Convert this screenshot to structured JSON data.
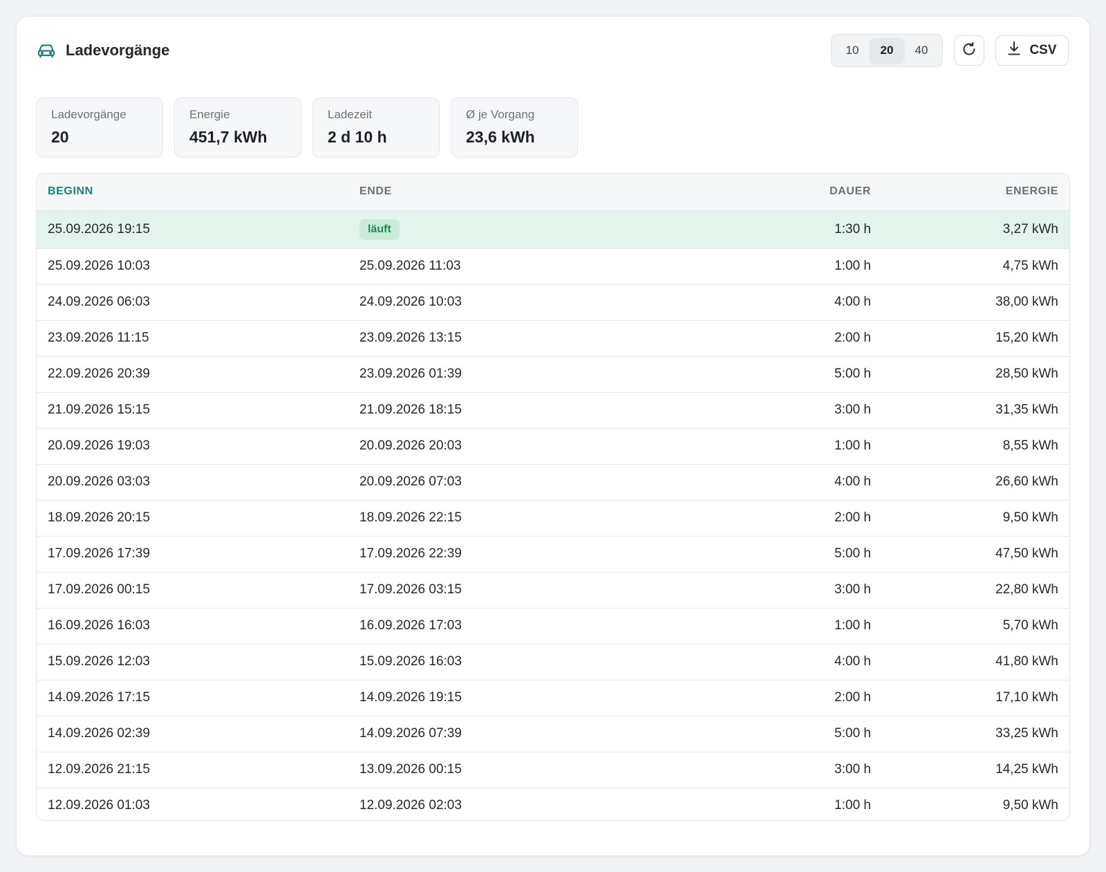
{
  "header": {
    "title": "Ladevorgänge",
    "page_sizes": [
      "10",
      "20",
      "40"
    ],
    "active_page_size": "20",
    "export_label": "CSV"
  },
  "stats": [
    {
      "label": "Ladevorgänge",
      "value": "20"
    },
    {
      "label": "Energie",
      "value": "451,7 kWh"
    },
    {
      "label": "Ladezeit",
      "value": "2 d 10 h"
    },
    {
      "label": "Ø je Vorgang",
      "value": "23,6 kWh"
    }
  ],
  "table": {
    "columns": [
      "BEGINN",
      "ENDE",
      "DAUER",
      "ENERGIE"
    ],
    "sorted_column": "BEGINN",
    "running_label": "läuft",
    "rows": [
      {
        "begin": "25.09.2026 19:15",
        "end": "",
        "running": true,
        "duration": "1:30 h",
        "energy": "3,27 kWh"
      },
      {
        "begin": "25.09.2026 10:03",
        "end": "25.09.2026 11:03",
        "running": false,
        "duration": "1:00 h",
        "energy": "4,75 kWh"
      },
      {
        "begin": "24.09.2026 06:03",
        "end": "24.09.2026 10:03",
        "running": false,
        "duration": "4:00 h",
        "energy": "38,00 kWh"
      },
      {
        "begin": "23.09.2026 11:15",
        "end": "23.09.2026 13:15",
        "running": false,
        "duration": "2:00 h",
        "energy": "15,20 kWh"
      },
      {
        "begin": "22.09.2026 20:39",
        "end": "23.09.2026 01:39",
        "running": false,
        "duration": "5:00 h",
        "energy": "28,50 kWh"
      },
      {
        "begin": "21.09.2026 15:15",
        "end": "21.09.2026 18:15",
        "running": false,
        "duration": "3:00 h",
        "energy": "31,35 kWh"
      },
      {
        "begin": "20.09.2026 19:03",
        "end": "20.09.2026 20:03",
        "running": false,
        "duration": "1:00 h",
        "energy": "8,55 kWh"
      },
      {
        "begin": "20.09.2026 03:03",
        "end": "20.09.2026 07:03",
        "running": false,
        "duration": "4:00 h",
        "energy": "26,60 kWh"
      },
      {
        "begin": "18.09.2026 20:15",
        "end": "18.09.2026 22:15",
        "running": false,
        "duration": "2:00 h",
        "energy": "9,50 kWh"
      },
      {
        "begin": "17.09.2026 17:39",
        "end": "17.09.2026 22:39",
        "running": false,
        "duration": "5:00 h",
        "energy": "47,50 kWh"
      },
      {
        "begin": "17.09.2026 00:15",
        "end": "17.09.2026 03:15",
        "running": false,
        "duration": "3:00 h",
        "energy": "22,80 kWh"
      },
      {
        "begin": "16.09.2026 16:03",
        "end": "16.09.2026 17:03",
        "running": false,
        "duration": "1:00 h",
        "energy": "5,70 kWh"
      },
      {
        "begin": "15.09.2026 12:03",
        "end": "15.09.2026 16:03",
        "running": false,
        "duration": "4:00 h",
        "energy": "41,80 kWh"
      },
      {
        "begin": "14.09.2026 17:15",
        "end": "14.09.2026 19:15",
        "running": false,
        "duration": "2:00 h",
        "energy": "17,10 kWh"
      },
      {
        "begin": "14.09.2026 02:39",
        "end": "14.09.2026 07:39",
        "running": false,
        "duration": "5:00 h",
        "energy": "33,25 kWh"
      },
      {
        "begin": "12.09.2026 21:15",
        "end": "13.09.2026 00:15",
        "running": false,
        "duration": "3:00 h",
        "energy": "14,25 kWh"
      },
      {
        "begin": "12.09.2026 01:03",
        "end": "12.09.2026 02:03",
        "running": false,
        "duration": "1:00 h",
        "energy": "9,50 kWh"
      }
    ]
  },
  "colors": {
    "accent": "#1d7f7a",
    "running_row": "#e3f4ec",
    "running_badge_bg": "#c9ebda",
    "running_badge_text": "#1c8a55"
  },
  "icons": {
    "title": "car-icon",
    "refresh": "refresh-icon",
    "export": "download-icon"
  }
}
